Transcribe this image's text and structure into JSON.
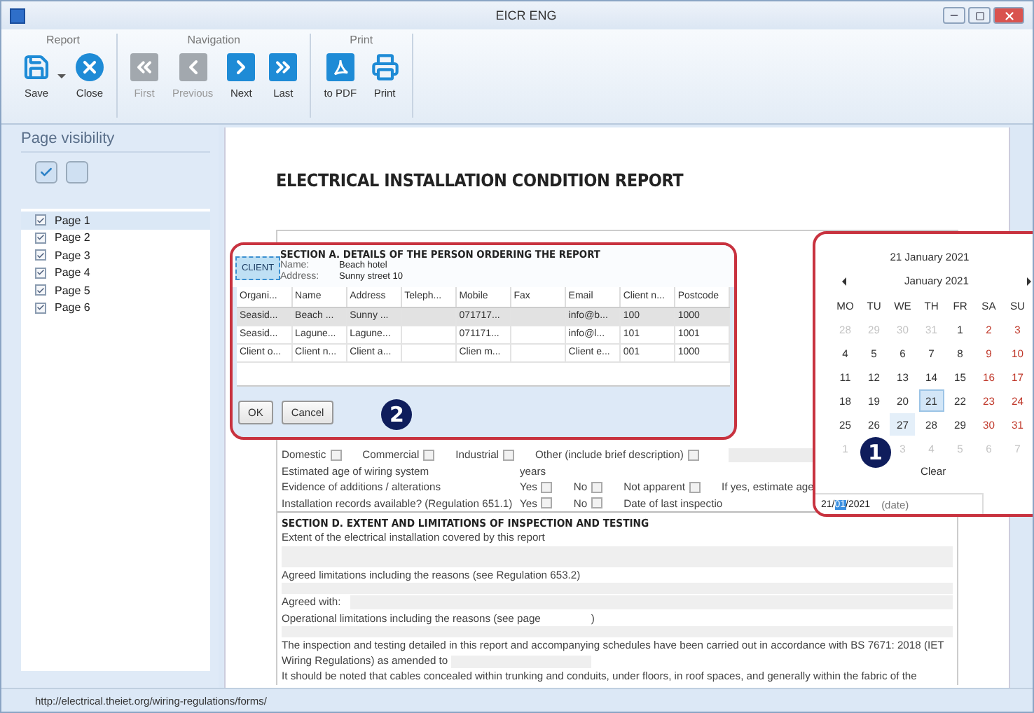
{
  "window": {
    "title": "EICR ENG"
  },
  "ribbon": {
    "groups": [
      {
        "label": "Report",
        "buttons": [
          {
            "kind": "save",
            "label": "Save",
            "disabled": false,
            "dropdown": true
          },
          {
            "kind": "close",
            "label": "Close",
            "disabled": false,
            "dropdown": false
          }
        ]
      },
      {
        "label": "Navigation",
        "buttons": [
          {
            "kind": "first",
            "label": "First",
            "disabled": true,
            "dropdown": false
          },
          {
            "kind": "previous",
            "label": "Previous",
            "disabled": true,
            "dropdown": false
          },
          {
            "kind": "next",
            "label": "Next",
            "disabled": false,
            "dropdown": false
          },
          {
            "kind": "last",
            "label": "Last",
            "disabled": false,
            "dropdown": false
          }
        ]
      },
      {
        "label": "Print",
        "buttons": [
          {
            "kind": "pdf",
            "label": "to PDF",
            "disabled": false,
            "dropdown": false
          },
          {
            "kind": "print",
            "label": "Print",
            "disabled": false,
            "dropdown": false
          }
        ]
      }
    ]
  },
  "sidebar": {
    "title": "Page visibility",
    "pages": [
      {
        "label": "Page 1",
        "checked": true,
        "selected": true
      },
      {
        "label": "Page 2",
        "checked": true,
        "selected": false
      },
      {
        "label": "Page 3",
        "checked": true,
        "selected": false
      },
      {
        "label": "Page 4",
        "checked": true,
        "selected": false
      },
      {
        "label": "Page 5",
        "checked": true,
        "selected": false
      },
      {
        "label": "Page 6",
        "checked": true,
        "selected": false
      }
    ]
  },
  "document": {
    "title": "ELECTRICAL INSTALLATION CONDITION REPORT",
    "premises_lines": [
      [
        {
          "kind": "text",
          "text": "Domestic"
        },
        {
          "kind": "checkbox",
          "checked": false
        },
        {
          "kind": "text",
          "text": "Commercial"
        },
        {
          "kind": "checkbox",
          "checked": false
        },
        {
          "kind": "text",
          "text": "Industrial"
        },
        {
          "kind": "checkbox",
          "checked": false
        },
        {
          "kind": "text",
          "text": "Other (include brief description)"
        },
        {
          "kind": "checkbox",
          "checked": false
        },
        {
          "kind": "fill"
        }
      ],
      [
        {
          "kind": "label",
          "text": "Estimated age of wiring system"
        },
        {
          "kind": "text",
          "text": "years"
        }
      ],
      [
        {
          "kind": "label",
          "text": "Evidence of additions / alterations"
        },
        {
          "kind": "text",
          "text": "Yes"
        },
        {
          "kind": "checkbox",
          "checked": false
        },
        {
          "kind": "text",
          "text": "No"
        },
        {
          "kind": "checkbox",
          "checked": false
        },
        {
          "kind": "text",
          "text": "Not apparent"
        },
        {
          "kind": "checkbox",
          "checked": false
        },
        {
          "kind": "text",
          "text": "If yes, estimate age"
        }
      ],
      [
        {
          "kind": "label",
          "text": "Installation records available? (Regulation 651.1)"
        },
        {
          "kind": "text",
          "text": "Yes"
        },
        {
          "kind": "checkbox",
          "checked": false
        },
        {
          "kind": "text",
          "text": "No"
        },
        {
          "kind": "checkbox",
          "checked": false
        },
        {
          "kind": "text",
          "text": "Date of last inspectio"
        }
      ]
    ],
    "section_d": {
      "heading": "SECTION D. EXTENT AND LIMITATIONS OF INSPECTION AND TESTING",
      "entries": [
        {
          "kind": "label",
          "text": "Extent of the electrical installation covered by this report"
        },
        {
          "kind": "area"
        },
        {
          "kind": "label",
          "text": "Agreed limitations including the reasons (see Regulation 653.2)"
        },
        {
          "kind": "area"
        },
        {
          "kind": "inline",
          "text": "Agreed with:"
        },
        {
          "kind": "inline",
          "text": "Operational limitations including the reasons (see page",
          "suffix": ")"
        },
        {
          "kind": "area"
        },
        {
          "kind": "paragraph",
          "text": "The inspection and testing detailed in this report and accompanying schedules have been carried out in accordance with BS 7671: 2018 (IET Wiring Regulations) as amended to"
        },
        {
          "kind": "label",
          "text": "It should be noted that cables concealed within trunking and conduits, under floors, in roof spaces, and generally within the fabric of the"
        }
      ]
    }
  },
  "client_popup": {
    "section_heading": "SECTION A. DETAILS OF THE PERSON ORDERING THE REPORT",
    "client_button": "CLIENT",
    "fields": [
      {
        "label": "Name:",
        "value": "Beach hotel"
      },
      {
        "label": "Address:",
        "value": "Sunny street 10"
      }
    ],
    "table": {
      "columns": [
        "Organi...",
        "Name",
        "Address",
        "Teleph...",
        "Mobile",
        "Fax",
        "Email",
        "Client n...",
        "Postcode"
      ],
      "rows": [
        {
          "selected": true,
          "cells": [
            "Seasid...",
            "Beach ...",
            "Sunny ...",
            "",
            "071717...",
            "",
            "info@b...",
            "100",
            "1000"
          ]
        },
        {
          "selected": false,
          "cells": [
            "Seasid...",
            "Lagune...",
            "Lagune...",
            "",
            "071171...",
            "",
            "info@l...",
            "101",
            "1001"
          ]
        },
        {
          "selected": false,
          "cells": [
            "Client o...",
            "Client n...",
            "Client a...",
            "",
            "Clien m...",
            "",
            "Client e...",
            "001",
            "1000"
          ]
        }
      ]
    },
    "buttons": [
      "OK",
      "Cancel"
    ],
    "badge": "2"
  },
  "calendar": {
    "heading": "21 January 2021",
    "month": "January 2021",
    "weekdays": [
      "MO",
      "TU",
      "WE",
      "TH",
      "FR",
      "SA",
      "SU"
    ],
    "weeks": [
      [
        {
          "day": "28",
          "kind": "other",
          "selected": false
        },
        {
          "day": "29",
          "kind": "other",
          "selected": false
        },
        {
          "day": "30",
          "kind": "other",
          "selected": false
        },
        {
          "day": "31",
          "kind": "other",
          "selected": false
        },
        {
          "day": "1",
          "kind": "day",
          "selected": false
        },
        {
          "day": "2",
          "kind": "weekend",
          "selected": false
        },
        {
          "day": "3",
          "kind": "weekend",
          "selected": false
        }
      ],
      [
        {
          "day": "4",
          "kind": "day",
          "selected": false
        },
        {
          "day": "5",
          "kind": "day",
          "selected": false
        },
        {
          "day": "6",
          "kind": "day",
          "selected": false
        },
        {
          "day": "7",
          "kind": "day",
          "selected": false
        },
        {
          "day": "8",
          "kind": "day",
          "selected": false
        },
        {
          "day": "9",
          "kind": "weekend",
          "selected": false
        },
        {
          "day": "10",
          "kind": "weekend",
          "selected": false
        }
      ],
      [
        {
          "day": "11",
          "kind": "day",
          "selected": false
        },
        {
          "day": "12",
          "kind": "day",
          "selected": false
        },
        {
          "day": "13",
          "kind": "day",
          "selected": false
        },
        {
          "day": "14",
          "kind": "day",
          "selected": false
        },
        {
          "day": "15",
          "kind": "day",
          "selected": false
        },
        {
          "day": "16",
          "kind": "weekend",
          "selected": false
        },
        {
          "day": "17",
          "kind": "weekend",
          "selected": false
        }
      ],
      [
        {
          "day": "18",
          "kind": "day",
          "selected": false
        },
        {
          "day": "19",
          "kind": "day",
          "selected": false
        },
        {
          "day": "20",
          "kind": "day",
          "selected": false
        },
        {
          "day": "21",
          "kind": "day",
          "selected": true
        },
        {
          "day": "22",
          "kind": "day",
          "selected": false
        },
        {
          "day": "23",
          "kind": "weekend",
          "selected": false
        },
        {
          "day": "24",
          "kind": "weekend",
          "selected": false
        }
      ],
      [
        {
          "day": "25",
          "kind": "day",
          "selected": false
        },
        {
          "day": "26",
          "kind": "day",
          "selected": false
        },
        {
          "day": "27",
          "kind": "today",
          "selected": false
        },
        {
          "day": "28",
          "kind": "day",
          "selected": false
        },
        {
          "day": "29",
          "kind": "day",
          "selected": false
        },
        {
          "day": "30",
          "kind": "weekend",
          "selected": false
        },
        {
          "day": "31",
          "kind": "weekend",
          "selected": false
        }
      ],
      [
        {
          "day": "1",
          "kind": "other",
          "selected": false
        },
        {
          "kind": "hidden"
        },
        {
          "day": "3",
          "kind": "other",
          "selected": false
        },
        {
          "day": "4",
          "kind": "other",
          "selected": false
        },
        {
          "day": "5",
          "kind": "other",
          "selected": false
        },
        {
          "day": "6",
          "kind": "other",
          "selected": false
        },
        {
          "day": "7",
          "kind": "other",
          "selected": false
        }
      ]
    ],
    "clear": "Clear",
    "badge": "1",
    "date_field": {
      "parts": [
        {
          "text": "21/",
          "selected": false
        },
        {
          "text": "01",
          "selected": true
        },
        {
          "text": "/2021",
          "selected": false
        }
      ],
      "hint": "(date)"
    }
  },
  "status_bar": {
    "url": "http://electrical.theiet.org/wiring-regulations/forms/"
  }
}
